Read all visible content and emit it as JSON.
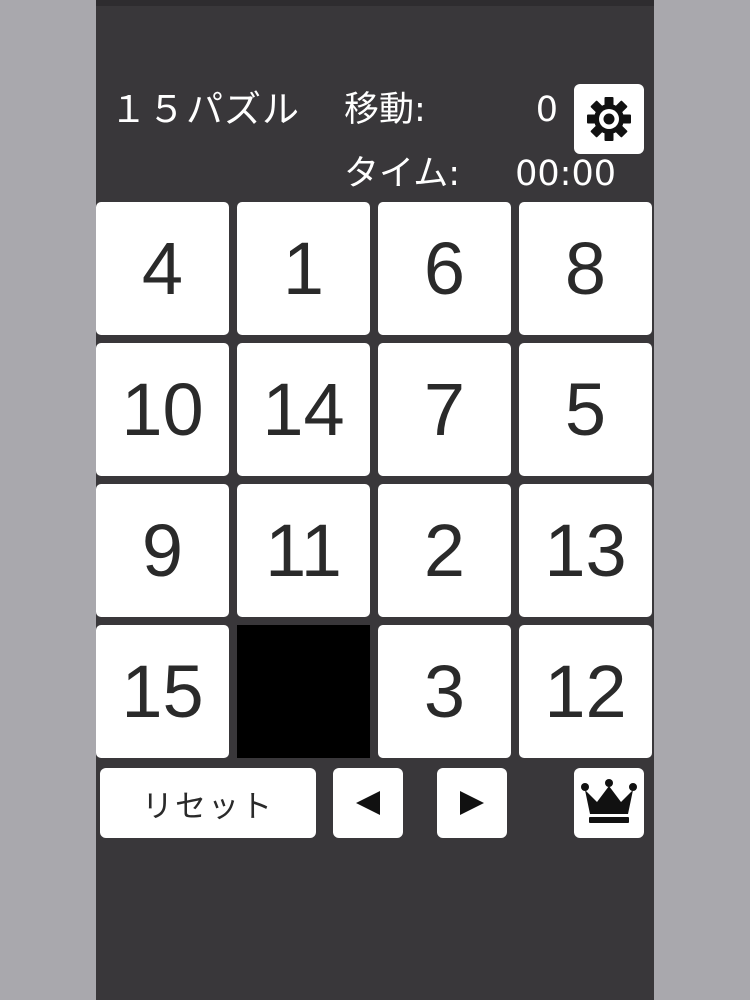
{
  "header": {
    "title": "１５パズル",
    "moves_label": "移動:",
    "moves_value": "0",
    "time_label": "タイム:",
    "time_value": "00:00",
    "settings_icon": "gear-icon"
  },
  "board": {
    "rows": 4,
    "cols": 4,
    "tiles": [
      "4",
      "1",
      "6",
      "8",
      "10",
      "14",
      "7",
      "5",
      "9",
      "11",
      "2",
      "13",
      "15",
      "",
      "3",
      "12"
    ]
  },
  "controls": {
    "reset_label": "リセット",
    "prev_icon": "triangle-left-icon",
    "next_icon": "triangle-right-icon",
    "ranking_icon": "crown-icon"
  },
  "colors": {
    "app_background": "#39373a",
    "outer_background": "#a9a8ad",
    "tile": "#ffffff",
    "empty_tile": "#000000",
    "text_dark": "#2a2a2a"
  }
}
